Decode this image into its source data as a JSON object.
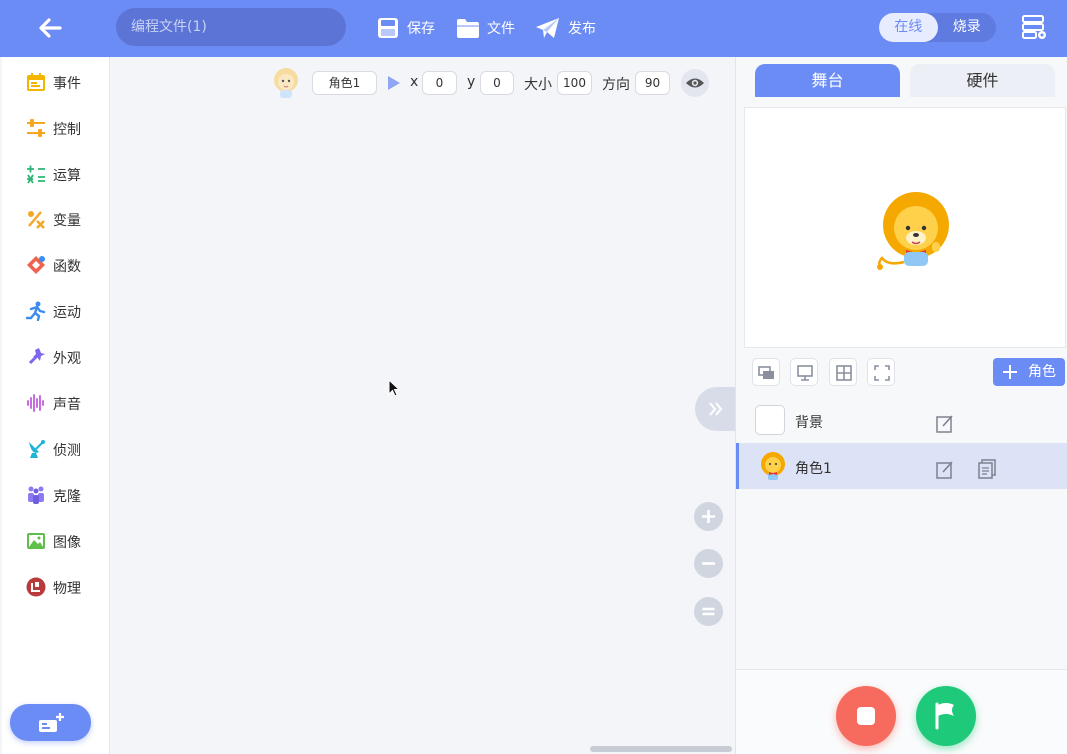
{
  "topbar": {
    "filename_placeholder": "编程文件(1)",
    "save_label": "保存",
    "file_label": "文件",
    "publish_label": "发布",
    "mode_online": "在线",
    "mode_burn": "烧录"
  },
  "sidebar": {
    "items": [
      {
        "label": "事件",
        "icon": "event-icon",
        "color": "#f5b400"
      },
      {
        "label": "控制",
        "icon": "control-icon",
        "color": "#f5a623"
      },
      {
        "label": "运算",
        "icon": "operator-icon",
        "color": "#2bb673"
      },
      {
        "label": "变量",
        "icon": "variable-icon",
        "color": "#f5a623"
      },
      {
        "label": "函数",
        "icon": "function-icon",
        "color": "#f0614e"
      },
      {
        "label": "运动",
        "icon": "motion-icon",
        "color": "#3b8cf0"
      },
      {
        "label": "外观",
        "icon": "looks-icon",
        "color": "#7b68ee"
      },
      {
        "label": "声音",
        "icon": "sound-icon",
        "color": "#c86de0"
      },
      {
        "label": "侦测",
        "icon": "sensing-icon",
        "color": "#1fb3d6"
      },
      {
        "label": "克隆",
        "icon": "clone-icon",
        "color": "#8a7bf0"
      },
      {
        "label": "图像",
        "icon": "image-icon",
        "color": "#5fbf4a"
      },
      {
        "label": "物理",
        "icon": "physics-icon",
        "color": "#b83a3a"
      }
    ]
  },
  "sprite_bar": {
    "name": "角色1",
    "x_label": "x",
    "x_value": "0",
    "y_label": "y",
    "y_value": "0",
    "size_label": "大小",
    "size_value": "100",
    "direction_label": "方向",
    "direction_value": "90"
  },
  "right_panel": {
    "tab_stage": "舞台",
    "tab_hardware": "硬件",
    "add_role_label": "角色",
    "list": [
      {
        "name": "背景"
      },
      {
        "name": "角色1"
      }
    ]
  },
  "colors": {
    "accent": "#6c8cf5",
    "stop": "#f76b5e",
    "go": "#1fc97a"
  }
}
